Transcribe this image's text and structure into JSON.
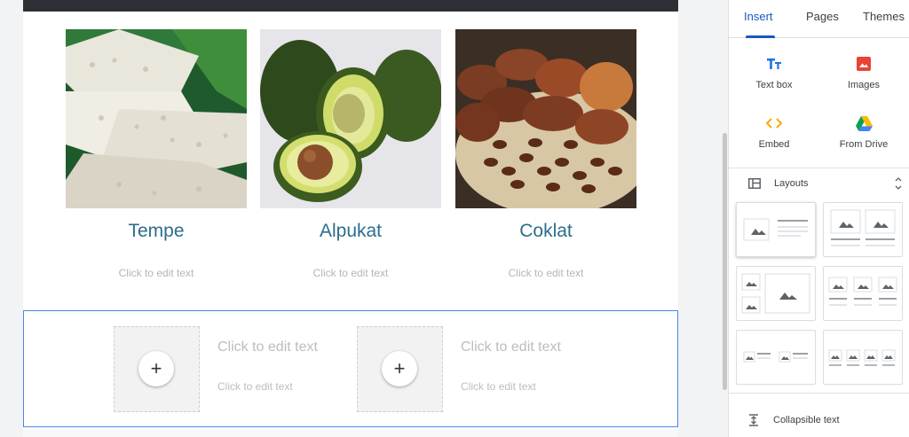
{
  "cards": [
    {
      "title": "Tempe",
      "body": "Click to edit text"
    },
    {
      "title": "Alpukat",
      "body": "Click to edit text"
    },
    {
      "title": "Coklat",
      "body": "Click to edit text"
    }
  ],
  "placeholders": [
    {
      "title": "Click to edit text",
      "body": "Click to edit text"
    },
    {
      "title": "Click to edit text",
      "body": "Click to edit text"
    }
  ],
  "panel": {
    "tabs": [
      "Insert",
      "Pages",
      "Themes"
    ],
    "active_tab": "Insert",
    "insert_items": [
      {
        "label": "Text box",
        "icon": "text-box-icon"
      },
      {
        "label": "Images",
        "icon": "image-icon"
      },
      {
        "label": "Embed",
        "icon": "embed-icon"
      },
      {
        "label": "From Drive",
        "icon": "drive-icon"
      }
    ],
    "layouts_label": "Layouts",
    "collapsible_label": "Collapsible text"
  },
  "colors": {
    "accent": "#1a56c5",
    "card_title": "#2c6d8c",
    "selection": "#4a86e8"
  }
}
